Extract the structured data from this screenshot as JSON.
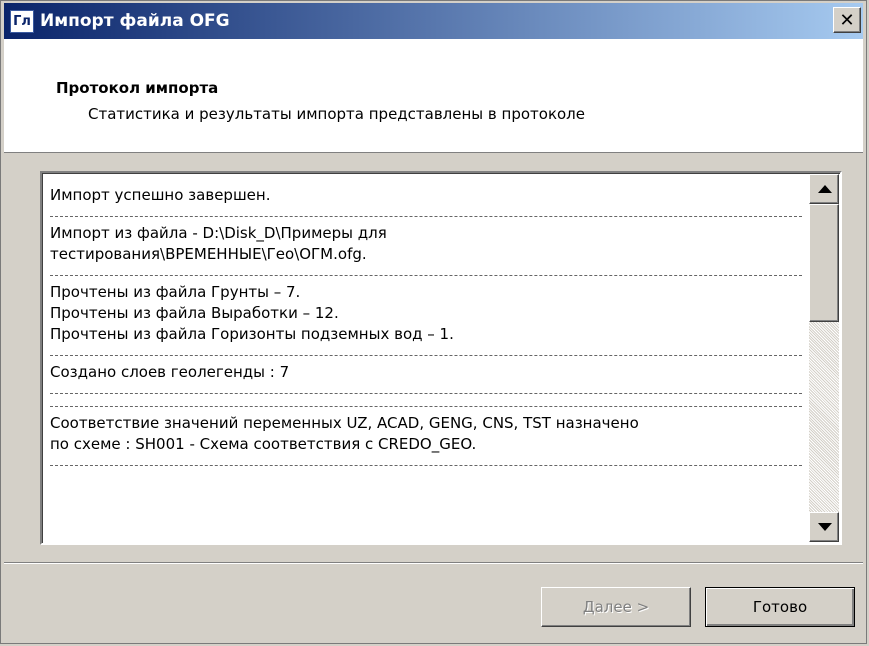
{
  "window": {
    "icon_text": "Гл",
    "title": "Импорт файла OFG",
    "close_label": "✕"
  },
  "header": {
    "title": "Протокол импорта",
    "subtitle": "Статистика и результаты импорта представлены в протоколе"
  },
  "log": {
    "blocks": [
      [
        "Импорт успешно завершен."
      ],
      [
        "Импорт из файла - D:\\Disk_D\\Примеры для",
        "тестирования\\ВРЕМЕННЫЕ\\Гео\\ОГМ.ofg."
      ],
      [
        "Прочтены из файла Грунты – 7.",
        "Прочтены из файла Выработки – 12.",
        "Прочтены из файла Горизонты подземных вод – 1."
      ],
      [
        "Создано слоев геолегенды : 7"
      ],
      [],
      [
        "Соответствие значений переменных UZ, ACAD, GENG, CNS, TST назначено",
        "по схеме : SH001 - Схема соответствия с CREDO_GEO."
      ]
    ]
  },
  "buttons": {
    "next_accel": "Д",
    "next_rest": "алее >",
    "done": "Готово"
  }
}
